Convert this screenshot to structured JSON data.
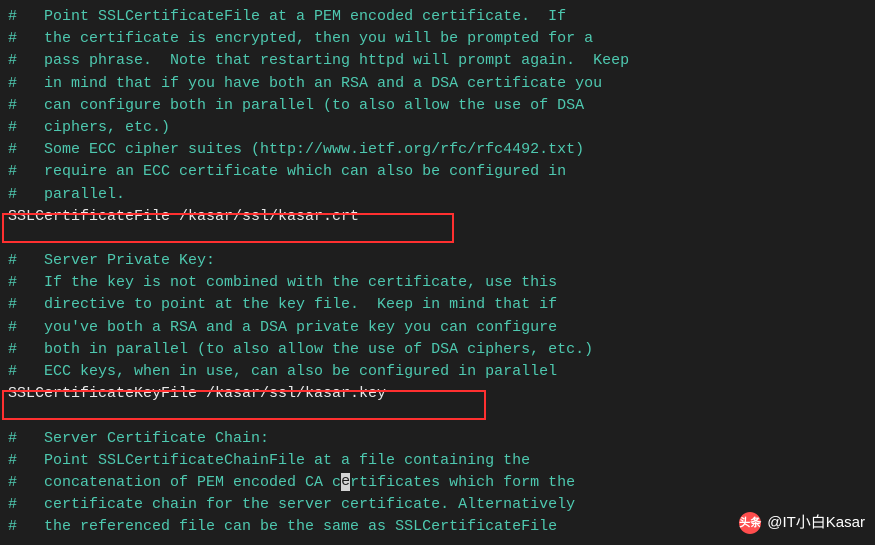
{
  "lines": [
    {
      "cls": "comment",
      "text": "#   Point SSLCertificateFile at a PEM encoded certificate.  If"
    },
    {
      "cls": "comment",
      "text": "#   the certificate is encrypted, then you will be prompted for a"
    },
    {
      "cls": "comment",
      "text": "#   pass phrase.  Note that restarting httpd will prompt again.  Keep"
    },
    {
      "cls": "comment",
      "text": "#   in mind that if you have both an RSA and a DSA certificate you"
    },
    {
      "cls": "comment",
      "text": "#   can configure both in parallel (to also allow the use of DSA"
    },
    {
      "cls": "comment",
      "text": "#   ciphers, etc.)"
    },
    {
      "cls": "comment",
      "text": "#   Some ECC cipher suites (http://www.ietf.org/rfc/rfc4492.txt)"
    },
    {
      "cls": "comment",
      "text": "#   require an ECC certificate which can also be configured in"
    },
    {
      "cls": "comment",
      "text": "#   parallel."
    },
    {
      "cls": "plain",
      "text": "SSLCertificateFile /kasar/ssl/kasar.crt"
    },
    {
      "cls": "plain",
      "text": ""
    },
    {
      "cls": "comment",
      "text": "#   Server Private Key:"
    },
    {
      "cls": "comment",
      "text": "#   If the key is not combined with the certificate, use this"
    },
    {
      "cls": "comment",
      "text": "#   directive to point at the key file.  Keep in mind that if"
    },
    {
      "cls": "comment",
      "text": "#   you've both a RSA and a DSA private key you can configure"
    },
    {
      "cls": "comment",
      "text": "#   both in parallel (to also allow the use of DSA ciphers, etc.)"
    },
    {
      "cls": "comment",
      "text": "#   ECC keys, when in use, can also be configured in parallel"
    },
    {
      "cls": "plain",
      "text": "SSLCertificateKeyFile /kasar/ssl/kasar.key"
    },
    {
      "cls": "plain",
      "text": ""
    },
    {
      "cls": "comment",
      "text": "#   Server Certificate Chain:"
    },
    {
      "cls": "comment",
      "text": "#   Point SSLCertificateChainFile at a file containing the"
    },
    {
      "cls": "comment",
      "special": "cursor",
      "text_pre": "#   concatenation of PEM encoded CA c",
      "cursor_char": "e",
      "text_post": "rtificates which form the"
    },
    {
      "cls": "comment",
      "text": "#   certificate chain for the server certificate. Alternatively"
    },
    {
      "cls": "comment",
      "text": "#   the referenced file can be the same as SSLCertificateFile"
    }
  ],
  "watermark": {
    "icon_text": "头条",
    "label": "@IT小白Kasar"
  }
}
